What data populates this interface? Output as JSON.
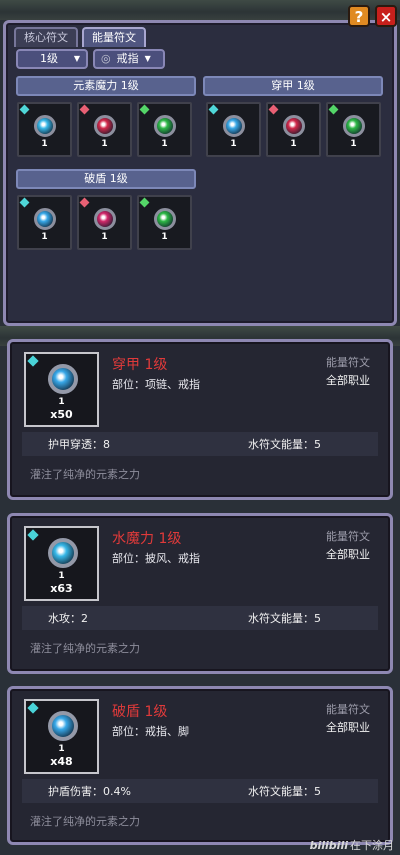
{
  "tabs": [
    "核心符文",
    "能量符文"
  ],
  "buttons": {
    "help": "?",
    "close": "×"
  },
  "filters": {
    "level": "1级",
    "slot": "戒指"
  },
  "groups": [
    {
      "name": "元素魔力 1级",
      "runes": [
        {
          "level": "1",
          "color": "#38b8e8",
          "gem": "#4fd7d8"
        },
        {
          "level": "1",
          "color": "#d2284a",
          "gem": "#e86074"
        },
        {
          "level": "1",
          "color": "#2db846",
          "gem": "#54d668"
        }
      ]
    },
    {
      "name": "穿甲 1级",
      "runes": [
        {
          "level": "1",
          "color": "#38a8e8",
          "gem": "#4fd7d8"
        },
        {
          "level": "1",
          "color": "#d2284a",
          "gem": "#e86074"
        },
        {
          "level": "1",
          "color": "#2db846",
          "gem": "#54d668"
        }
      ]
    },
    {
      "name": "破盾 1级",
      "runes": [
        {
          "level": "1",
          "color": "#38a8e8",
          "gem": "#4fd7d8"
        },
        {
          "level": "1",
          "color": "#d2286a",
          "gem": "#e86074"
        },
        {
          "level": "1",
          "color": "#2db846",
          "gem": "#54d668"
        }
      ]
    }
  ],
  "cards": [
    {
      "title": "穿甲 1级",
      "slots": "部位：项链、戒指",
      "type": "能量符文",
      "cls": "全部职业",
      "level": "1",
      "count": "x50",
      "stat": "护甲穿透：8",
      "energy": "水符文能量：5",
      "flavor": "灌注了纯净的元素之力",
      "rune_color": "#38a8e8"
    },
    {
      "title": "水魔力 1级",
      "slots": "部位：披风、戒指",
      "type": "能量符文",
      "cls": "全部职业",
      "level": "1",
      "count": "x63",
      "stat": "水攻：2",
      "energy": "水符文能量：5",
      "flavor": "灌注了纯净的元素之力",
      "rune_color": "#38b8e8"
    },
    {
      "title": "破盾 1级",
      "slots": "部位：戒指、脚",
      "type": "能量符文",
      "cls": "全部职业",
      "level": "1",
      "count": "x48",
      "stat": "护盾伤害：0.4%",
      "energy": "水符文能量：5",
      "flavor": "灌注了纯净的元素之力",
      "rune_color": "#38a8e8"
    }
  ],
  "watermark": {
    "logo": "bilibili",
    "author": "在下涂月"
  }
}
